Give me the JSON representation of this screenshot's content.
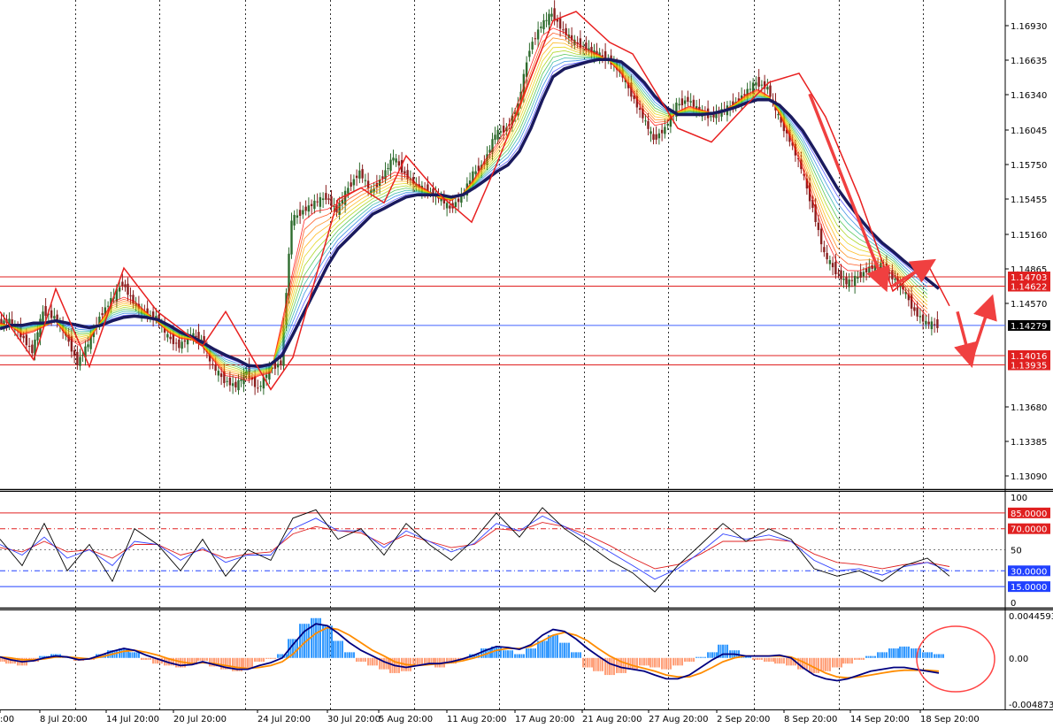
{
  "chart_data": {
    "type": "line",
    "instrument_hint": "",
    "price_axis": {
      "ticks": [
        "1.16930",
        "1.16635",
        "1.16340",
        "1.16045",
        "1.15750",
        "1.15455",
        "1.15160",
        "1.14865",
        "1.14570",
        "1.13680",
        "1.13385",
        "1.13090"
      ],
      "range": [
        1.1285,
        1.1712
      ]
    },
    "time_axis": {
      "ticks": [
        ":00",
        "8 Jul 20:00",
        "14 Jul 20:00",
        "20 Jul 20:00",
        "24 Jul 20:00",
        "30 Jul 20:00",
        "5 Aug 20:00",
        "11 Aug 20:00",
        "17 Aug 20:00",
        "21 Aug 20:00",
        "27 Aug 20:00",
        "2 Sep 20:00",
        "8 Sep 20:00",
        "14 Sep 20:00",
        "18 Sep 20:00"
      ]
    },
    "price_levels": [
      {
        "value": 1.14703,
        "label": "1.14703",
        "color": "#e02020"
      },
      {
        "value": 1.14622,
        "label": "1.14622",
        "color": "#e02020"
      },
      {
        "value": 1.14279,
        "label": "1.14279",
        "color": "#4060ff"
      },
      {
        "value": 1.14016,
        "label": "1.14016",
        "color": "#e02020"
      },
      {
        "value": 1.13935,
        "label": "1.13935",
        "color": "#e02020"
      }
    ],
    "current_price": "1.14279",
    "price_series": {
      "t": [
        0,
        12,
        25,
        38,
        50,
        63,
        76,
        89,
        101,
        114,
        127,
        140,
        152,
        165,
        178,
        191,
        204,
        217,
        229,
        242,
        255,
        268,
        280,
        293,
        306,
        319,
        331,
        344,
        357,
        370,
        382,
        395,
        408,
        421,
        434,
        446,
        459,
        472,
        485,
        497,
        510,
        523,
        536,
        549,
        561,
        574,
        587,
        600,
        613,
        625,
        638,
        651,
        664,
        676,
        689,
        702,
        715,
        728,
        740,
        753,
        766,
        779,
        792,
        805,
        817,
        830,
        843,
        856,
        869,
        881,
        894,
        907,
        920,
        933,
        946,
        958,
        971,
        984,
        997,
        1010,
        1022,
        1035,
        1048,
        1061,
        1074,
        1086
      ],
      "close": [
        1.143,
        1.1432,
        1.142,
        1.1405,
        1.144,
        1.1435,
        1.142,
        1.1395,
        1.1412,
        1.1435,
        1.145,
        1.1465,
        1.1448,
        1.1438,
        1.1435,
        1.1418,
        1.141,
        1.142,
        1.1415,
        1.1392,
        1.138,
        1.1375,
        1.1388,
        1.1372,
        1.139,
        1.1395,
        1.152,
        1.1528,
        1.1535,
        1.154,
        1.1528,
        1.1548,
        1.1562,
        1.1544,
        1.1558,
        1.1575,
        1.156,
        1.155,
        1.1545,
        1.154,
        1.153,
        1.154,
        1.156,
        1.157,
        1.1595,
        1.16,
        1.162,
        1.167,
        1.169,
        1.17,
        1.1685,
        1.1675,
        1.167,
        1.1665,
        1.166,
        1.165,
        1.163,
        1.161,
        1.159,
        1.16,
        1.162,
        1.1625,
        1.1615,
        1.161,
        1.1615,
        1.162,
        1.163,
        1.164,
        1.1635,
        1.161,
        1.159,
        1.1565,
        1.153,
        1.149,
        1.1475,
        1.1465,
        1.147,
        1.1478,
        1.148,
        1.147,
        1.146,
        1.144,
        1.143,
        1.1428
      ],
      "ma_slow": [
        1.1425,
        1.1428,
        1.1428,
        1.143,
        1.143,
        1.1432,
        1.143,
        1.1428,
        1.1426,
        1.1428,
        1.1432,
        1.1435,
        1.1436,
        1.1435,
        1.1433,
        1.1428,
        1.1422,
        1.1418,
        1.1413,
        1.1407,
        1.1402,
        1.1398,
        1.1393,
        1.1392,
        1.1394,
        1.1402,
        1.142,
        1.144,
        1.146,
        1.148,
        1.1495,
        1.1505,
        1.1515,
        1.1525,
        1.153,
        1.1535,
        1.154,
        1.1542,
        1.1542,
        1.1542,
        1.154,
        1.1542,
        1.1548,
        1.1555,
        1.1562,
        1.1568,
        1.158,
        1.16,
        1.1625,
        1.1645,
        1.1652,
        1.1655,
        1.1658,
        1.166,
        1.166,
        1.1658,
        1.165,
        1.164,
        1.1628,
        1.1618,
        1.1612,
        1.1612,
        1.1612,
        1.1613,
        1.1615,
        1.1618,
        1.1622,
        1.1625,
        1.1625,
        1.162,
        1.161,
        1.1598,
        1.1582,
        1.1565,
        1.1548,
        1.1535,
        1.1522,
        1.151,
        1.15,
        1.1492,
        1.1484,
        1.1476,
        1.1468,
        1.146
      ]
    },
    "zigzag": {
      "t": [
        0,
        38,
        63,
        101,
        140,
        178,
        229,
        255,
        306,
        331,
        382,
        408,
        434,
        459,
        497,
        533,
        561,
        625,
        651,
        689,
        715,
        766,
        804,
        843,
        869,
        903,
        933,
        971,
        1009,
        1048,
        1073
      ],
      "price": [
        1.144,
        1.1398,
        1.146,
        1.1392,
        1.1478,
        1.144,
        1.141,
        1.144,
        1.1372,
        1.14,
        1.1538,
        1.1548,
        1.1535,
        1.1576,
        1.1542,
        1.1518,
        1.1568,
        1.1694,
        1.1702,
        1.1675,
        1.1665,
        1.16,
        1.1588,
        1.162,
        1.164,
        1.1648,
        1.161,
        1.154,
        1.1458,
        1.1482,
        1.1445
      ]
    },
    "projection_arrows": [
      {
        "from_t": 915,
        "from_p": 1.163,
        "to_t": 1000,
        "to_p": 1.1462
      },
      {
        "from_t": 1008,
        "from_p": 1.1462,
        "to_t": 1052,
        "to_p": 1.1483
      },
      {
        "from_t": 1082,
        "from_p": 1.144,
        "to_t": 1097,
        "to_p": 1.1396
      },
      {
        "from_t": 1097,
        "from_p": 1.1396,
        "to_t": 1120,
        "to_p": 1.145
      }
    ],
    "stochastic": {
      "axis_ticks": [
        "100",
        "50",
        "0"
      ],
      "levels": [
        {
          "value": 85,
          "label": "85.0000",
          "color": "#e02020"
        },
        {
          "value": 70,
          "label": "70.0000",
          "color": "#e02020"
        },
        {
          "value": 30,
          "label": "30.0000",
          "color": "#2040ff"
        },
        {
          "value": 15,
          "label": "15.0000",
          "color": "#2040ff"
        }
      ],
      "t": [
        0,
        25,
        50,
        76,
        101,
        127,
        152,
        178,
        204,
        229,
        255,
        280,
        306,
        331,
        357,
        382,
        408,
        434,
        459,
        485,
        510,
        536,
        561,
        587,
        613,
        638,
        664,
        689,
        715,
        740,
        766,
        792,
        817,
        843,
        869,
        894,
        920,
        946,
        971,
        997,
        1022,
        1048,
        1073
      ],
      "k": [
        60,
        35,
        75,
        30,
        55,
        20,
        70,
        55,
        30,
        60,
        25,
        50,
        40,
        80,
        88,
        60,
        70,
        45,
        75,
        55,
        40,
        60,
        85,
        62,
        90,
        70,
        55,
        40,
        28,
        10,
        35,
        55,
        75,
        58,
        70,
        60,
        32,
        25,
        30,
        20,
        35,
        42,
        25
      ],
      "d": [
        55,
        45,
        62,
        42,
        50,
        35,
        58,
        55,
        40,
        52,
        38,
        45,
        45,
        70,
        80,
        68,
        68,
        52,
        68,
        58,
        48,
        56,
        75,
        68,
        82,
        72,
        60,
        48,
        35,
        22,
        32,
        48,
        65,
        60,
        64,
        58,
        40,
        30,
        32,
        26,
        34,
        38,
        30
      ],
      "slow": [
        52,
        48,
        58,
        48,
        50,
        42,
        55,
        55,
        45,
        50,
        42,
        46,
        48,
        65,
        72,
        68,
        66,
        55,
        64,
        58,
        52,
        55,
        70,
        68,
        76,
        72,
        64,
        54,
        42,
        32,
        36,
        46,
        58,
        58,
        60,
        58,
        46,
        38,
        36,
        32,
        36,
        38,
        34
      ]
    },
    "macd": {
      "axis_ticks": [
        "0.0044593",
        "0.00",
        "-0.0048737"
      ],
      "range": [
        -0.0048737,
        0.0044593
      ],
      "t": [
        0,
        12,
        25,
        38,
        50,
        63,
        76,
        89,
        101,
        114,
        127,
        140,
        152,
        165,
        178,
        191,
        204,
        217,
        229,
        242,
        255,
        268,
        280,
        293,
        306,
        319,
        331,
        344,
        357,
        370,
        382,
        395,
        408,
        421,
        434,
        446,
        459,
        472,
        485,
        497,
        510,
        523,
        536,
        549,
        561,
        574,
        587,
        600,
        613,
        625,
        638,
        651,
        664,
        676,
        689,
        702,
        715,
        728,
        740,
        753,
        766,
        779,
        792,
        805,
        817,
        830,
        843,
        856,
        869,
        881,
        894,
        907,
        920,
        933,
        946,
        958,
        971,
        984,
        997,
        1010,
        1022,
        1035,
        1048,
        1061,
        1074,
        1086
      ],
      "hist": [
        -0.0004,
        -0.0006,
        -0.0008,
        -0.0004,
        0.0002,
        0.0004,
        0.0001,
        -0.0003,
        -0.0002,
        0.0004,
        0.0008,
        0.001,
        0.0006,
        -0.0002,
        -0.0006,
        -0.0008,
        -0.001,
        -0.0007,
        -0.0003,
        -0.0009,
        -0.0012,
        -0.0014,
        -0.001,
        -0.0004,
        -0.0001,
        0.0004,
        0.002,
        0.0036,
        0.0042,
        0.0034,
        0.0018,
        0.0006,
        -0.0004,
        -0.0008,
        -0.0012,
        -0.0016,
        -0.0014,
        -0.0008,
        -0.0006,
        -0.001,
        -0.0006,
        -0.0002,
        0.0004,
        0.001,
        0.0012,
        0.0008,
        0.0004,
        0.001,
        0.0018,
        0.0024,
        0.0016,
        0.0006,
        -0.001,
        -0.0014,
        -0.0018,
        -0.0016,
        -0.0012,
        -0.0008,
        -0.001,
        -0.0012,
        -0.0008,
        -0.0004,
        0.0001,
        0.0006,
        0.0014,
        0.0008,
        0.0002,
        -0.0002,
        -0.0004,
        -0.0006,
        -0.0008,
        -0.0012,
        -0.0016,
        -0.0014,
        -0.001,
        -0.0006,
        -0.0002,
        0.0002,
        0.0006,
        0.001,
        0.0012,
        0.001,
        0.0006,
        0.0004
      ],
      "line": [
        0.0001,
        -0.0002,
        -0.0004,
        -0.0003,
        0.0,
        0.0002,
        0.0001,
        -0.0002,
        -0.0001,
        0.0003,
        0.0007,
        0.001,
        0.0008,
        0.0003,
        -0.0001,
        -0.0005,
        -0.0008,
        -0.0007,
        -0.0004,
        -0.0007,
        -0.001,
        -0.0012,
        -0.0012,
        -0.0008,
        -0.0005,
        0.0,
        0.0014,
        0.0028,
        0.0036,
        0.0034,
        0.0026,
        0.0016,
        0.0008,
        0.0002,
        -0.0004,
        -0.0008,
        -0.001,
        -0.0008,
        -0.0006,
        -0.0006,
        -0.0004,
        -0.0001,
        0.0003,
        0.0008,
        0.0012,
        0.0011,
        0.0009,
        0.0014,
        0.0024,
        0.003,
        0.0028,
        0.002,
        0.001,
        0.0002,
        -0.0006,
        -0.001,
        -0.0012,
        -0.0014,
        -0.0018,
        -0.0022,
        -0.0022,
        -0.0018,
        -0.001,
        -0.0002,
        0.0004,
        0.0004,
        0.0002,
        0.0002,
        0.0002,
        0.0003,
        0.0,
        -0.001,
        -0.0018,
        -0.0022,
        -0.0024,
        -0.0022,
        -0.0018,
        -0.0014,
        -0.0012,
        -0.001,
        -0.001,
        -0.0012,
        -0.0014,
        -0.0016
      ],
      "signal": [
        0.0001,
        0.0,
        -0.0002,
        -0.0002,
        -0.0001,
        0.0001,
        0.0001,
        0.0,
        -0.0001,
        0.0001,
        0.0004,
        0.0007,
        0.0008,
        0.0006,
        0.0003,
        -0.0001,
        -0.0004,
        -0.0006,
        -0.0005,
        -0.0006,
        -0.0008,
        -0.001,
        -0.0011,
        -0.001,
        -0.0008,
        -0.0004,
        0.0004,
        0.0016,
        0.0026,
        0.0032,
        0.003,
        0.0024,
        0.0016,
        0.0008,
        0.0002,
        -0.0004,
        -0.0007,
        -0.0008,
        -0.0007,
        -0.0006,
        -0.0005,
        -0.0003,
        0.0,
        0.0004,
        0.0008,
        0.001,
        0.001,
        0.0012,
        0.0018,
        0.0024,
        0.0027,
        0.0024,
        0.0018,
        0.001,
        0.0002,
        -0.0004,
        -0.0008,
        -0.0011,
        -0.0014,
        -0.0018,
        -0.002,
        -0.002,
        -0.0016,
        -0.001,
        -0.0004,
        0.0,
        0.0002,
        0.0002,
        0.0002,
        0.0002,
        0.0001,
        -0.0004,
        -0.001,
        -0.0016,
        -0.002,
        -0.0021,
        -0.002,
        -0.0018,
        -0.0016,
        -0.0014,
        -0.0013,
        -0.0013,
        -0.0013,
        -0.0014
      ]
    }
  },
  "colors": {
    "grid": "#000000",
    "axis_text": "#000000",
    "bull_candle": "#2d6b2d",
    "bear_candle": "#8a1f1f",
    "ma_slow": "#1a1a5e",
    "zigzag": "#e82020",
    "arrow": "#f04040",
    "stoch_k": "#000000",
    "stoch_d": "#3040ff",
    "stoch_slow": "#e02020",
    "macd_pos": "#3399ff",
    "macd_neg": "#ffa07a",
    "macd_line": "#000080",
    "macd_signal": "#ff8c00",
    "highlight_circle": "#ff4444"
  }
}
